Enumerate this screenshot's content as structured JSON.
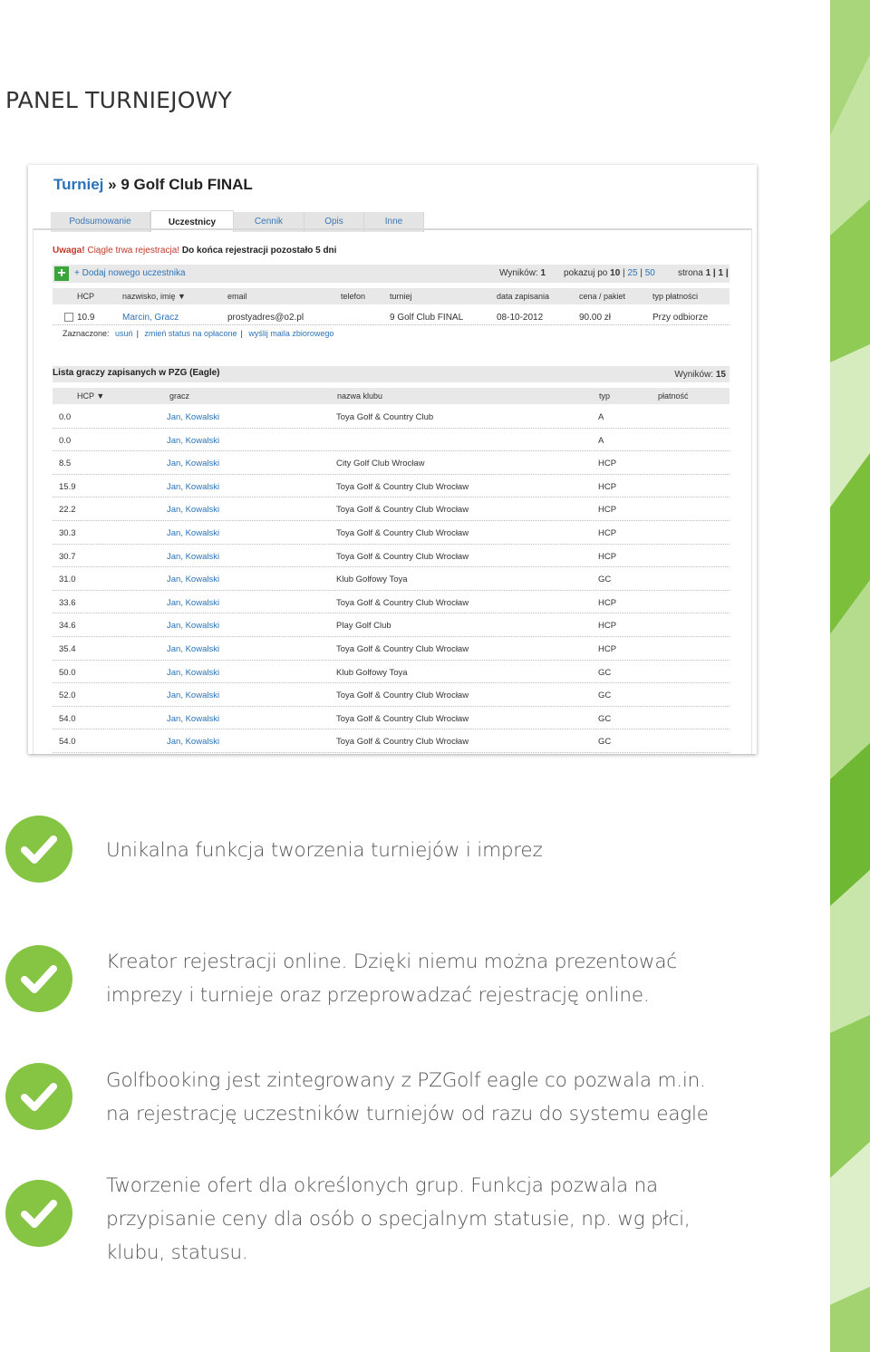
{
  "page": {
    "title": "PANEL TURNIEJOWY"
  },
  "panel": {
    "title_link": "Turniej",
    "title_sep": " » ",
    "title_name": "9 Golf Club FINAL",
    "tabs": [
      {
        "label": "Podsumowanie"
      },
      {
        "label": "Uczestnicy"
      },
      {
        "label": "Cennik"
      },
      {
        "label": "Opis"
      },
      {
        "label": "Inne"
      }
    ],
    "active_tab": "Uczestnicy",
    "warning_label": "Uwaga!",
    "warning_text": "Ciągle trwa rejestracja!",
    "warning_days": "Do końca rejestracji pozostało 5 dni",
    "add_participant": "+ Dodaj nowego uczestnika",
    "results_label": "Wyników:",
    "results_value": "1",
    "show_label": "pokazuj po",
    "show_options": [
      "10",
      "25",
      "50"
    ],
    "page_label": "strona",
    "page_value": "1 | 1 |",
    "participants_headers": {
      "hcp": "HCP",
      "name": "nazwisko, imię ▼",
      "email": "email",
      "phone": "telefon",
      "tournament": "turniej",
      "date": "data zapisania",
      "price": "cena / pakiet",
      "payment": "typ płatności"
    },
    "participant": {
      "hcp": "10.9",
      "name": "Marcin, Gracz",
      "email": "prostyadres@o2.pl",
      "phone": "",
      "tournament": "9 Golf Club FINAL",
      "date": "08-10-2012",
      "price": "90.00 zł",
      "payment": "Przy odbiorze"
    },
    "selected_label": "Zaznaczone:",
    "selected_actions": [
      "usuń",
      "zmień status na opłacone",
      "wyślij maila zbiorowego"
    ],
    "eagle_list_title": "Lista graczy zapisanych w PZG (Eagle)",
    "eagle_results_label": "Wyników:",
    "eagle_results_value": "15",
    "eagle_headers": {
      "hcp": "HCP ▼",
      "player": "gracz",
      "club": "nazwa klubu",
      "type": "typ",
      "payment": "płatność"
    },
    "eagle_rows": [
      {
        "hcp": "0.0",
        "player": "Jan, Kowalski",
        "club": "Toya Golf & Country Club",
        "type": "A"
      },
      {
        "hcp": "0.0",
        "player": "Jan, Kowalski",
        "club": "",
        "type": "A"
      },
      {
        "hcp": "8.5",
        "player": "Jan, Kowalski",
        "club": "City Golf Club Wrocław",
        "type": "HCP"
      },
      {
        "hcp": "15.9",
        "player": "Jan, Kowalski",
        "club": "Toya Golf & Country Club Wrocław",
        "type": "HCP"
      },
      {
        "hcp": "22.2",
        "player": "Jan, Kowalski",
        "club": "Toya Golf & Country Club Wrocław",
        "type": "HCP"
      },
      {
        "hcp": "30.3",
        "player": "Jan, Kowalski",
        "club": "Toya Golf & Country Club Wrocław",
        "type": "HCP"
      },
      {
        "hcp": "30.7",
        "player": "Jan, Kowalski",
        "club": "Toya Golf & Country Club Wrocław",
        "type": "HCP"
      },
      {
        "hcp": "31.0",
        "player": "Jan, Kowalski",
        "club": "Klub Golfowy Toya",
        "type": "GC"
      },
      {
        "hcp": "33.6",
        "player": "Jan, Kowalski",
        "club": "Toya Golf & Country Club Wrocław",
        "type": "HCP"
      },
      {
        "hcp": "34.6",
        "player": "Jan, Kowalski",
        "club": "Play Golf Club",
        "type": "HCP"
      },
      {
        "hcp": "35.4",
        "player": "Jan, Kowalski",
        "club": "Toya Golf & Country Club Wrocław",
        "type": "HCP"
      },
      {
        "hcp": "50.0",
        "player": "Jan, Kowalski",
        "club": "Klub Golfowy Toya",
        "type": "GC"
      },
      {
        "hcp": "52.0",
        "player": "Jan, Kowalski",
        "club": "Toya Golf & Country Club Wrocław",
        "type": "GC"
      },
      {
        "hcp": "54.0",
        "player": "Jan, Kowalski",
        "club": "Toya Golf & Country Club Wrocław",
        "type": "GC"
      },
      {
        "hcp": "54.0",
        "player": "Jan, Kowalski",
        "club": "Toya Golf & Country Club Wrocław",
        "type": "GC"
      }
    ]
  },
  "features": [
    {
      "lines": [
        "Unikalna funkcja tworzenia turniejów i imprez"
      ]
    },
    {
      "lines": [
        "Kreator rejestracji online. Dzięki niemu można prezentować",
        "imprezy i turnieje oraz przeprowadzać rejestrację online."
      ]
    },
    {
      "lines": [
        "Golfbooking jest zintegrowany z PZGolf eagle co pozwala m.in.",
        "na rejestrację uczestników turniejów od razu do systemu eagle"
      ]
    },
    {
      "lines": [
        "Tworzenie ofert dla określonych grup. Funkcja pozwala na",
        "przypisanie ceny dla osób o specjalnym statusie, np. wg płci,",
        "klubu, statusu."
      ]
    }
  ],
  "colors": {
    "accent_green": "#86c444",
    "link_blue": "#2a73b9",
    "warning_red": "#c0392b"
  },
  "icons": {
    "feature_bullet": "checkmark-icon",
    "add": "plus-icon",
    "checkbox": "checkbox-icon"
  }
}
